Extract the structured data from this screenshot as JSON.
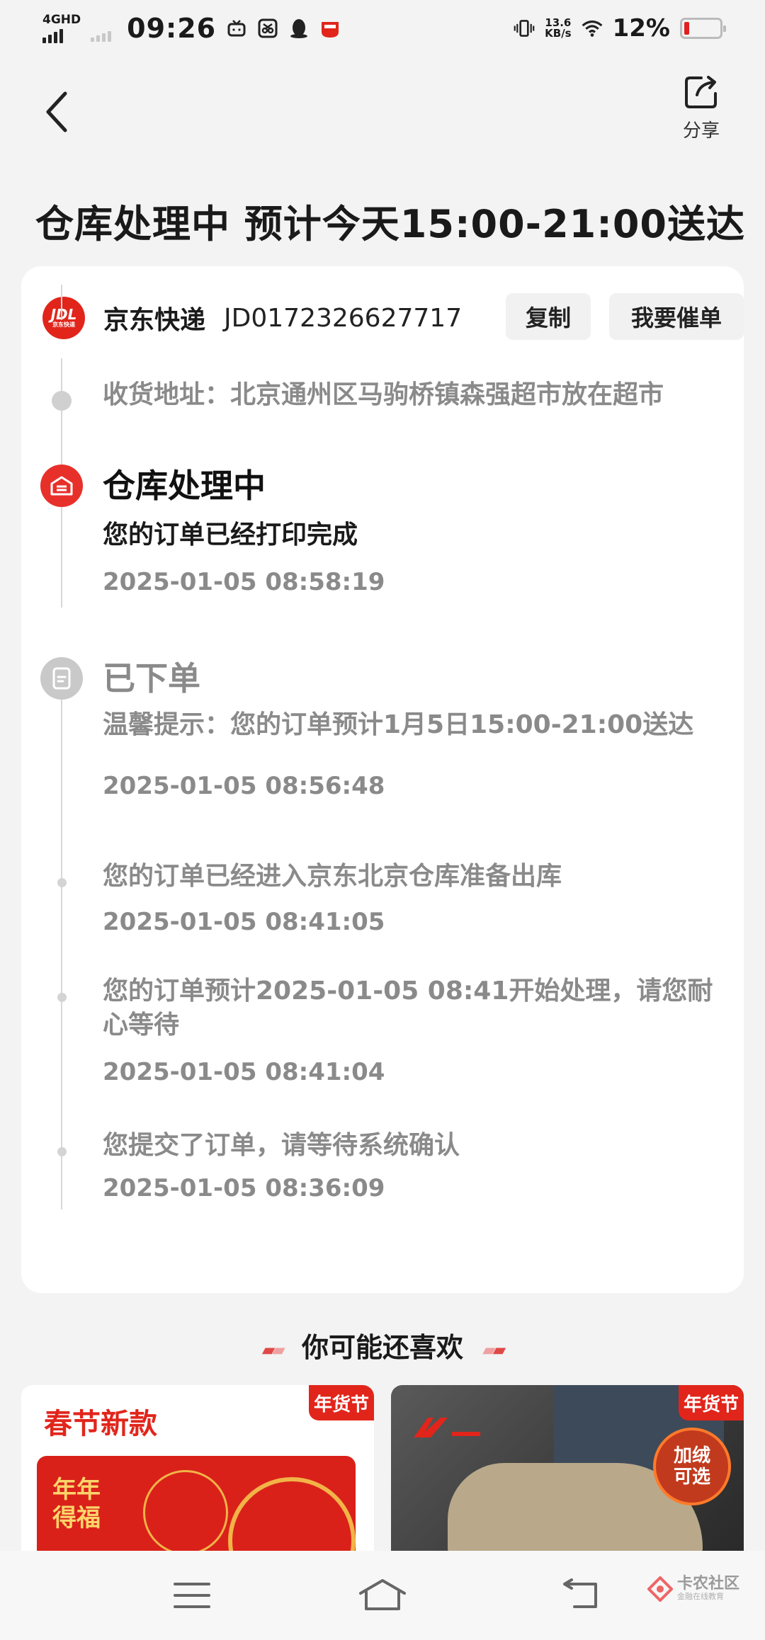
{
  "status_bar": {
    "network": "4GHD",
    "time": "09:26",
    "net_speed_value": "13.6",
    "net_speed_unit": "KB/s",
    "battery": "12%",
    "battery_level": 0.12
  },
  "header": {
    "share_label": "分享",
    "title": "仓库处理中 预计今天15:00-21:00送达"
  },
  "carrier": {
    "logo_text": "JDL",
    "logo_sub": "京东快递",
    "name": "京东快递",
    "tracking_no": "JD0172326627717",
    "copy_label": "复制",
    "urge_label": "我要催单"
  },
  "timeline": {
    "address": "收货地址：北京通州区马驹桥镇森强超市放在超市",
    "stage1": {
      "status": "仓库处理中",
      "desc": "您的订单已经打印完成",
      "time": "2025-01-05 08:58:19"
    },
    "stage2": {
      "status": "已下单",
      "events": [
        {
          "desc": "温馨提示：您的订单预计1月5日15:00-21:00送达",
          "time": "2025-01-05 08:56:48"
        },
        {
          "desc": "您的订单已经进入京东北京仓库准备出库",
          "time": "2025-01-05 08:41:05"
        },
        {
          "desc": "您的订单预计2025-01-05 08:41开始处理，请您耐心等待",
          "time": "2025-01-05 08:41:04"
        },
        {
          "desc": "您提交了订单，请等待系统确认",
          "time": "2025-01-05 08:36:09"
        }
      ]
    }
  },
  "recommend": {
    "title": "你可能还喜欢",
    "items": [
      {
        "tag": "年货节",
        "title": "春节新款",
        "card_text": "年年得福"
      },
      {
        "tag": "年货节",
        "badge": "加绒可选"
      }
    ]
  },
  "watermark": {
    "name": "卡农社区",
    "sub": "金融在线教育"
  },
  "colors": {
    "brand_red": "#e1251b",
    "grey_text": "#8a8a8a",
    "background": "#f3f3f3"
  }
}
